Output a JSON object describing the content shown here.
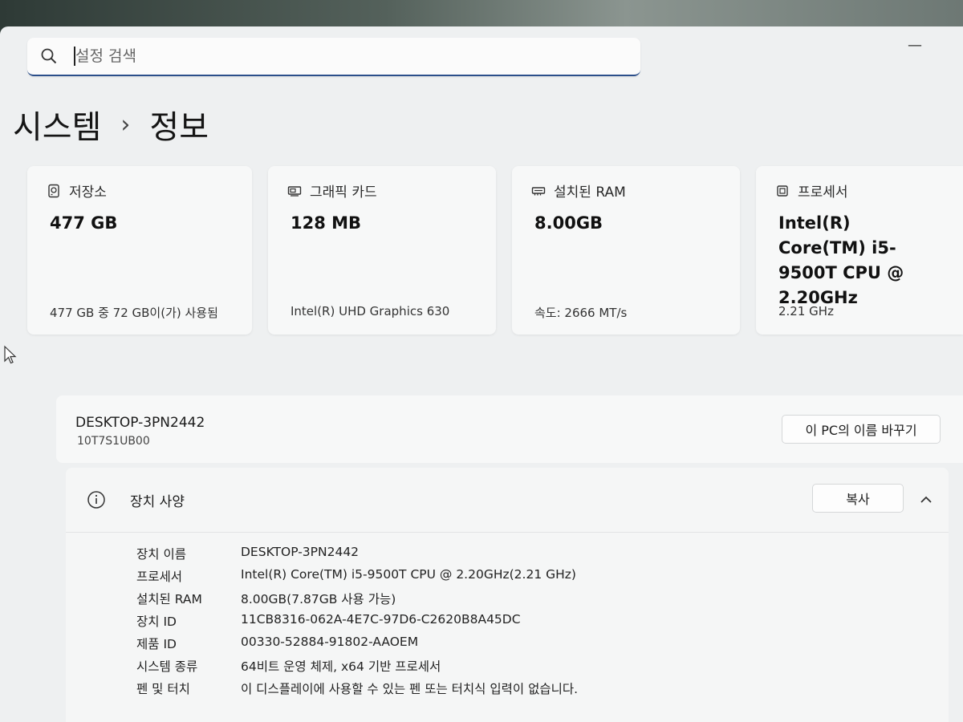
{
  "search": {
    "placeholder": "설정 검색"
  },
  "window": {
    "minimize": "—"
  },
  "breadcrumb": {
    "parent": "시스템",
    "separator": "›",
    "current": "정보"
  },
  "cards": [
    {
      "icon": "storage-icon",
      "title": "저장소",
      "value": "477 GB",
      "sub": "477 GB 중 72 GB이(가) 사용됨"
    },
    {
      "icon": "graphics-card-icon",
      "title": "그래픽 카드",
      "value": "128 MB",
      "sub": "Intel(R) UHD Graphics 630"
    },
    {
      "icon": "ram-icon",
      "title": "설치된 RAM",
      "value": "8.00GB",
      "sub": "속도: 2666 MT/s"
    },
    {
      "icon": "processor-icon",
      "title": "프로세서",
      "value": "Intel(R) Core(TM) i5-9500T CPU @ 2.20GHz",
      "sub": "2.21 GHz"
    }
  ],
  "pc": {
    "name": "DESKTOP-3PN2442",
    "model": "10T7S1UB00",
    "rename_label": "이 PC의 이름 바꾸기"
  },
  "specs": {
    "title": "장치 사양",
    "copy_label": "복사",
    "rows": [
      {
        "key": "장치 이름",
        "value": "DESKTOP-3PN2442"
      },
      {
        "key": "프로세서",
        "value": "Intel(R) Core(TM) i5-9500T CPU @ 2.20GHz(2.21 GHz)"
      },
      {
        "key": "설치된 RAM",
        "value": "8.00GB(7.87GB 사용 가능)"
      },
      {
        "key": "장치 ID",
        "value": "11CB8316-062A-4E7C-97D6-C2620B8A45DC"
      },
      {
        "key": "제품 ID",
        "value": "00330-52884-91802-AAOEM"
      },
      {
        "key": "시스템 종류",
        "value": "64비트 운영 체제, x64 기반 프로세서"
      },
      {
        "key": "펜 및 터치",
        "value": "이 디스플레이에 사용할 수 있는 펜 또는 터치식 입력이 없습니다."
      }
    ]
  }
}
